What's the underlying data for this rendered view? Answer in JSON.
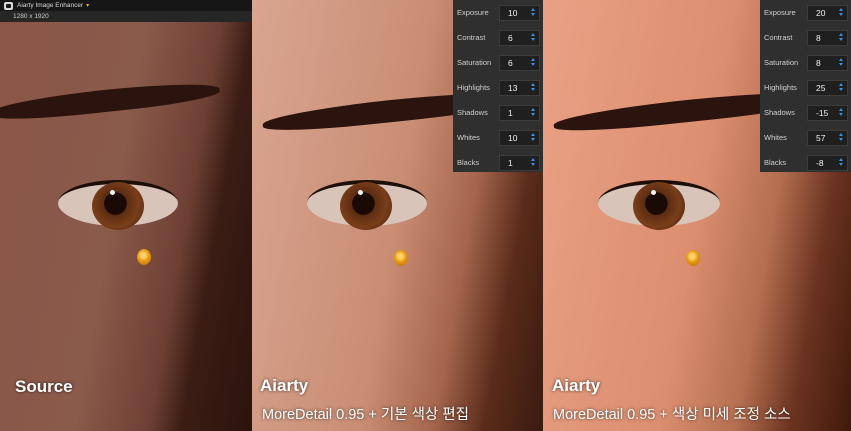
{
  "app": {
    "title": "Aiarty Image Enhancer",
    "resolution": "1280 x 1920"
  },
  "panels": [
    {
      "label": "Source",
      "sublabel": ""
    },
    {
      "label": "Aiarty",
      "sublabel": "MoreDetail 0.95 + 기본 색상 편집"
    },
    {
      "label": "Aiarty",
      "sublabel": "MoreDetail 0.95 + 색상 미세 조정 소스"
    }
  ],
  "adjust_panels": [
    {
      "rows": [
        {
          "name": "Exposure",
          "value": "10"
        },
        {
          "name": "Contrast",
          "value": "6"
        },
        {
          "name": "Saturation",
          "value": "6"
        },
        {
          "name": "Highlights",
          "value": "13"
        },
        {
          "name": "Shadows",
          "value": "1"
        },
        {
          "name": "Whites",
          "value": "10"
        },
        {
          "name": "Blacks",
          "value": "1"
        }
      ]
    },
    {
      "rows": [
        {
          "name": "Exposure",
          "value": "20"
        },
        {
          "name": "Contrast",
          "value": "8"
        },
        {
          "name": "Saturation",
          "value": "8"
        },
        {
          "name": "Highlights",
          "value": "25"
        },
        {
          "name": "Shadows",
          "value": "-15"
        },
        {
          "name": "Whites",
          "value": "57"
        },
        {
          "name": "Blacks",
          "value": "-8"
        }
      ]
    }
  ],
  "colors": {
    "accent": "#e8b21a",
    "spinner": "#3a8fe0"
  }
}
